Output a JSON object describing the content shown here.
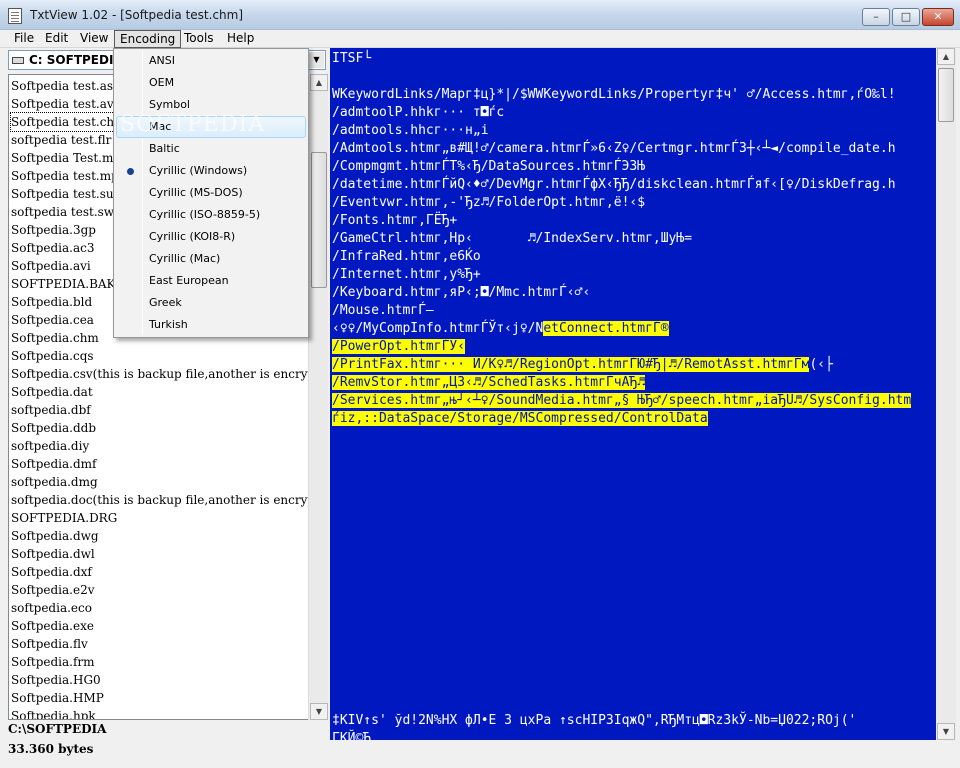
{
  "window": {
    "title": "TxtView 1.02 - [Softpedia test.chm]",
    "buttons": {
      "minimize": "–",
      "maximize": "□",
      "close": "✕"
    }
  },
  "menubar": [
    "File",
    "Edit",
    "View",
    "Encoding",
    "Tools",
    "Help"
  ],
  "encoding_menu": {
    "items": [
      "ANSI",
      "OEM",
      "Symbol",
      "Mac",
      "Baltic",
      "Cyrillic (Windows)",
      "Cyrillic (MS-DOS)",
      "Cyrillic (ISO-8859-5)",
      "Cyrillic (KOI8-R)",
      "Cyrillic (Mac)",
      "East European",
      "Greek",
      "Turkish"
    ],
    "checked": "Cyrillic (Windows)",
    "hovered": "Mac"
  },
  "drive_combo": {
    "value": "C:  SOFTPEDI"
  },
  "file_list": {
    "selected": "Softpedia test.chm",
    "items": [
      "Softpedia test.asf",
      "Softpedia test.avi",
      "Softpedia test.chm",
      "softpedia test.flr",
      "Softpedia Test.mp",
      "Softpedia test.mpg",
      "Softpedia test.sub",
      "softpedia test.swf",
      "Softpedia.3gp",
      "Softpedia.ac3",
      "Softpedia.avi",
      "SOFTPEDIA.BAK",
      "Softpedia.bld",
      "Softpedia.cea",
      "Softpedia.chm",
      "Softpedia.cqs",
      "Softpedia.csv(this is backup file,another is encrypted",
      "Softpedia.dat",
      "softpedia.dbf",
      "Softpedia.ddb",
      "softpedia.diy",
      "Softpedia.dmf",
      "softpedia.dmg",
      "softpedia.doc(this is backup file,another is encrypted",
      "SOFTPEDIA.DRG",
      "Softpedia.dwg",
      "Softpedia.dwl",
      "Softpedia.dxf",
      "Softpedia.e2v",
      "softpedia.eco",
      "Softpedia.exe",
      "Softpedia.flv",
      "Softpedia.frm",
      "Softpedia.HG0",
      "Softpedia.HMP",
      "Softpedia.hpk"
    ]
  },
  "status": {
    "path": "C:\\SOFTPEDIA",
    "size": "33.360 bytes"
  },
  "watermark": "SOFTPEDIA",
  "viewer": {
    "colors": {
      "background": "#0018c0",
      "text": "#ffffff",
      "highlight": "#ffff00"
    },
    "lines": [
      {
        "pre": "ITSF└",
        "hl": "",
        "post": ""
      },
      {
        "pre": "",
        "hl": "",
        "post": ""
      },
      {
        "pre": "WKeywordLinks/Mapг‡ц}*|/$WWKeywordLinks/Propertyг‡ч' ♂/Access.htmг,ѓO‰l!",
        "hl": "",
        "post": ""
      },
      {
        "pre": "/admtoolP.hhkг··· т◘ѓc",
        "hl": "",
        "post": ""
      },
      {
        "pre": "/admtools.hhcг···н„i",
        "hl": "",
        "post": ""
      },
      {
        "pre": "/Admtools.htmг„в#Щ!♂/camera.htmгЃ»6‹Z♀/Certmgr.htmгЃЗ┼‹┴◄/compile_date.h",
        "hl": "",
        "post": ""
      },
      {
        "pre": "/Compmgmt.htmгЃТ%‹Ђ/DataSources.htmгЃЭЗЊ",
        "hl": "",
        "post": ""
      },
      {
        "pre": "/datetime.htmгЃйQ‹♦♂/DevMgr.htmгЃфХ‹ЂЂ/diskclean.htmгЃяf‹[♀/DiskDefrag.h",
        "hl": "",
        "post": ""
      },
      {
        "pre": "/Eventvwr.htmг,-'Ђz♬/FolderOpt.htmг,ё!‹$",
        "hl": "",
        "post": ""
      },
      {
        "pre": "/Fonts.htmг,ГЁЂ+",
        "hl": "",
        "post": ""
      },
      {
        "pre": "/GameCtrl.htmг,Нр‹       ♬/IndexServ.htmг,ШуЊ=",
        "hl": "",
        "post": ""
      },
      {
        "pre": "/InfraRed.htmг,е6Ќо",
        "hl": "",
        "post": ""
      },
      {
        "pre": "/Internet.htmг,у%Ђ+",
        "hl": "",
        "post": ""
      },
      {
        "pre": "/Keyboard.htmг,яР‹;◘/Mmc.htmгЃ‹♂‹",
        "hl": "",
        "post": ""
      },
      {
        "pre": "/Mouse.htmгЃ–",
        "hl": "",
        "post": ""
      },
      {
        "pre": "‹♀♀/MyCompInfo.htmгЃЎт‹j♀/N",
        "hl": "etConnect.htmгЃ®",
        "post": ""
      },
      {
        "pre": "",
        "hl": "/PowerOpt.htmгЃУ‹",
        "post": ""
      },
      {
        "pre": "",
        "hl": "/PrintFax.htmг··· И/К♀♬/RegionOpt.htmгЃЮ#Ђ|♬/RemotAsst.htmгЃм",
        "post": "(‹├"
      },
      {
        "pre": "",
        "hl": "/RemvStor.htmг„ЦЗ‹♬/SchedTasks.htmгЃчАЂ♬",
        "post": ""
      },
      {
        "pre": "",
        "hl": "/Services.htmг„њ┘‹┴♀/SoundMedia.htmг„§ ЊЂ♂/speech.htmг„iaЂU♬/SysConfig.htm",
        "post": ""
      },
      {
        "pre": "",
        "hl": "ѓiz,::DataSpace/Storage/MSCompressed/ControlData",
        "post": ""
      }
    ],
    "bottom_lines": [
      "‡KIV↑s' ўd!2N%НХ фЛ•Е З цхРа ↑scHIP3IqжQ\",RЂМтц◘Rz3kЎ-Nb=Џ022;RОј('",
      "ГКЙ©Ђ"
    ]
  }
}
